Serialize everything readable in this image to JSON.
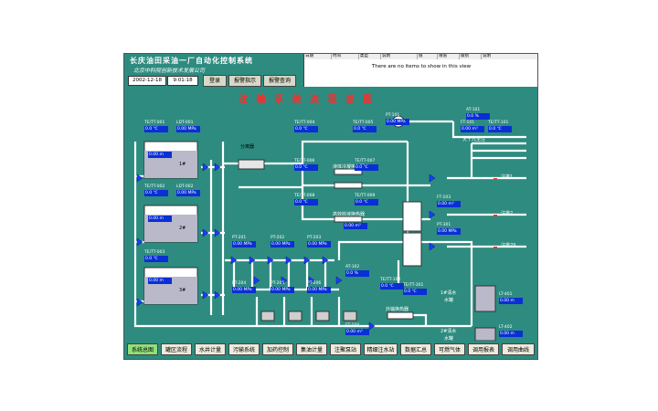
{
  "header": {
    "title": "长庆油田采油一厂自动化控制系统",
    "subtitle": "北京中科院创新技术发展公司",
    "date": "2002-12-18",
    "time": "9:01:18",
    "buttons": [
      "登录",
      "报警指示",
      "报警查询"
    ]
  },
  "alarm_panel": {
    "columns": [
      "日期",
      "时间",
      "类型",
      "说明",
      "值",
      "限值",
      "级别",
      "说明"
    ],
    "empty_message": "There are no items to show in this view"
  },
  "diagram": {
    "title": "注 输 系 统 流 程 总 图",
    "labels": {
      "separator": "分离器",
      "exchanger_top": "液体冷凝换热器",
      "exchanger_mid": "高效收液换热器",
      "exchanger_bottom": "外输换热器",
      "outlet_main": "天十九至注",
      "branch_1": "注排1",
      "branch_2": "注排2",
      "branch_29": "注排29",
      "water_tank_1": "1#清水",
      "water_tank_2": "2#清水",
      "tank_word": "水罐",
      "tank1": "1#",
      "tank2": "2#",
      "tank3": "3#"
    },
    "tanks": [
      {
        "tag": "LT-101",
        "value": "0.00 m"
      },
      {
        "tag": "LT-102",
        "value": "0.00 m"
      },
      {
        "tag": "LT-103",
        "value": "0.00 m"
      }
    ],
    "water_tanks": [
      {
        "tag": "LT-401",
        "value": "0.00 m"
      },
      {
        "tag": "LT-402",
        "value": "0.00 m"
      }
    ],
    "tags": [
      {
        "tag": "TE/TT-001",
        "value": "0.0 ℃"
      },
      {
        "tag": "LDT-001",
        "value": "0.00 MPa"
      },
      {
        "tag": "TE/TT-002",
        "value": "0.0 ℃"
      },
      {
        "tag": "LDT-002",
        "value": "0.00 MPa"
      },
      {
        "tag": "TE/TT-003",
        "value": "0.0 ℃"
      },
      {
        "tag": "TE/TT-004",
        "value": "0.0 ℃"
      },
      {
        "tag": "TE/TT-005",
        "value": "0.0 ℃"
      },
      {
        "tag": "TE/TT-006",
        "value": "0.0 ℃"
      },
      {
        "tag": "TE/TT-007",
        "value": "0.0 ℃"
      },
      {
        "tag": "TE/TT-008",
        "value": "0.0 ℃"
      },
      {
        "tag": "TE/TT-009",
        "value": "0.0 ℃"
      },
      {
        "tag": "PT-101",
        "value": "0.00 MPa"
      },
      {
        "tag": "AT-101",
        "value": "0.0 %"
      },
      {
        "tag": "FT-101",
        "value": "0.00 m³"
      },
      {
        "tag": "TE/TT-101",
        "value": "0.0 ℃"
      },
      {
        "tag": "FT-102",
        "value": "0.00 m³"
      },
      {
        "tag": "PT-201",
        "value": "0.00 MPa"
      },
      {
        "tag": "PT-202",
        "value": "0.00 MPa"
      },
      {
        "tag": "PT-203",
        "value": "0.00 MPa"
      },
      {
        "tag": "PT-204",
        "value": "0.00 MPa"
      },
      {
        "tag": "PT-205",
        "value": "0.00 MPa"
      },
      {
        "tag": "PT-206",
        "value": "0.00 MPa"
      },
      {
        "tag": "TE/TT-102",
        "value": "0.0 ℃"
      },
      {
        "tag": "AT-102",
        "value": "0.0 %"
      },
      {
        "tag": "FT-103",
        "value": "0.00 m³"
      },
      {
        "tag": "PT-301",
        "value": "0.00 MPa"
      },
      {
        "tag": "FT-104",
        "value": "0.00 m³"
      },
      {
        "tag": "TE/TT-301",
        "value": "0.0 ℃"
      }
    ]
  },
  "nav": {
    "items": [
      "系统总图",
      "罐区流程",
      "水井计量",
      "污输系统",
      "加药控制",
      "集油计量",
      "注聚泵站",
      "精细注水站",
      "数据汇总",
      "可燃气体",
      "调用报表",
      "调用曲线"
    ]
  }
}
